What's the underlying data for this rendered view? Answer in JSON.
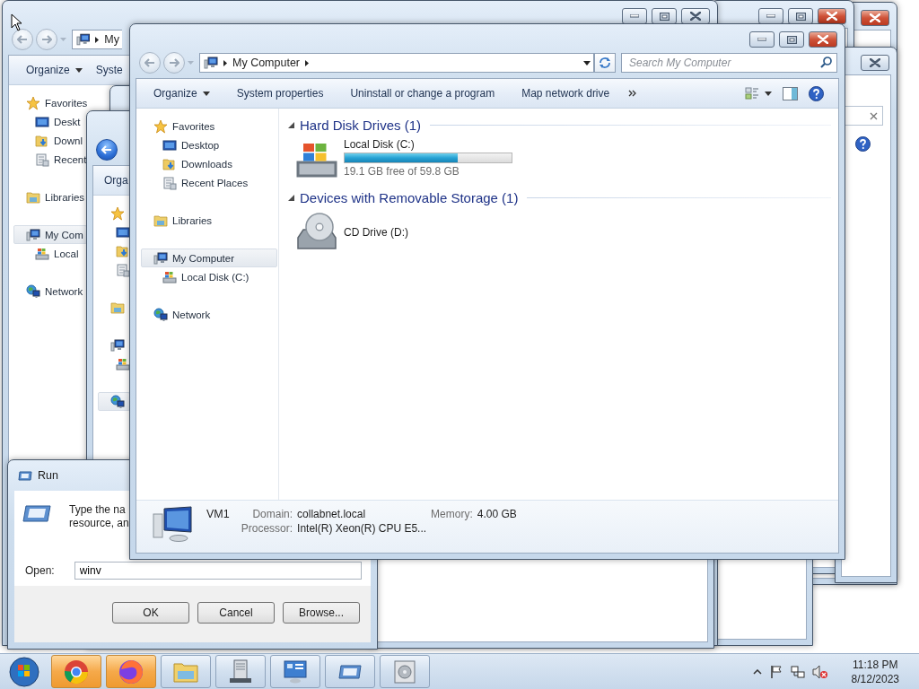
{
  "back_explorer": {
    "back_enabled": false,
    "address": "My",
    "toolbar": [
      {
        "label": "Organize",
        "dropdown": true
      },
      {
        "label": "Syste",
        "dropdown": false
      }
    ],
    "nav": [
      {
        "label": "Favorites",
        "kind": "favorites",
        "selected": false,
        "children": [
          {
            "label": "Deskt",
            "kind": "desktop",
            "selected": false
          },
          {
            "label": "Downl",
            "kind": "downloads",
            "selected": false
          },
          {
            "label": "Recent",
            "kind": "recent",
            "selected": false
          }
        ]
      },
      {
        "label": "Libraries",
        "kind": "libraries",
        "selected": false
      },
      {
        "label": "My Com",
        "kind": "computer",
        "selected": true,
        "children": [
          {
            "label": "Local",
            "kind": "disk",
            "selected": false
          }
        ]
      },
      {
        "label": "Network",
        "kind": "network",
        "selected": false
      }
    ]
  },
  "middle_explorer": {
    "back_enabled": true,
    "toolbar": [
      {
        "label": "Orga"
      }
    ],
    "nav": [
      {
        "kind": "favorites",
        "selected": false,
        "children": [
          {
            "kind": "desktop",
            "selected": false
          },
          {
            "kind": "downloads",
            "selected": false
          },
          {
            "kind": "recent",
            "selected": false
          }
        ]
      },
      {
        "kind": "libraries",
        "selected": false
      },
      {
        "kind": "computer",
        "selected": false,
        "children": [
          {
            "kind": "disk",
            "selected": false
          }
        ]
      },
      {
        "kind": "network",
        "selected": true
      }
    ]
  },
  "run_dialog": {
    "title": "Run",
    "prompt": [
      "Type the na",
      "resource, an"
    ],
    "open_label": "Open:",
    "value": "winv",
    "buttons": [
      "OK",
      "Cancel",
      "Browse..."
    ]
  },
  "main_window": {
    "back_enabled": false,
    "address": "My Computer",
    "search": {
      "placeholder": "Search My Computer"
    },
    "toolbar": [
      {
        "label": "Organize",
        "dropdown": true
      },
      {
        "label": "System properties",
        "dropdown": false
      },
      {
        "label": "Uninstall or change a program",
        "dropdown": false
      },
      {
        "label": "Map network drive",
        "dropdown": false
      }
    ],
    "nav": [
      {
        "label": "Favorites",
        "kind": "favorites",
        "selected": false,
        "children": [
          {
            "label": "Desktop",
            "kind": "desktop",
            "selected": false
          },
          {
            "label": "Downloads",
            "kind": "downloads",
            "selected": false
          },
          {
            "label": "Recent Places",
            "kind": "recent",
            "selected": false
          }
        ]
      },
      {
        "label": "Libraries",
        "kind": "libraries",
        "selected": false
      },
      {
        "label": "My Computer",
        "kind": "computer",
        "selected": true,
        "children": [
          {
            "label": "Local Disk (C:)",
            "kind": "disk",
            "selected": false
          }
        ]
      },
      {
        "label": "Network",
        "kind": "network",
        "selected": false
      }
    ],
    "groups": [
      {
        "title": "Hard Disk Drives (1)",
        "expanded": true,
        "items": [
          {
            "name": "Local Disk (C:)",
            "kind": "disk",
            "level": 0.68,
            "detail": "19.1 GB free of 59.8 GB"
          }
        ]
      },
      {
        "title": "Devices with Removable Storage (1)",
        "expanded": true,
        "items": [
          {
            "name": "CD Drive (D:)",
            "kind": "cd"
          }
        ]
      }
    ],
    "details": {
      "name": "VM1",
      "fields": [
        {
          "label": "Domain:",
          "value": "collabnet.local"
        },
        {
          "label": "Memory:",
          "value": "4.00 GB"
        },
        {
          "label": "Processor:",
          "value": "Intel(R) Xeon(R) CPU E5..."
        }
      ]
    }
  },
  "taskbar": {
    "apps": [
      {
        "kind": "chrome",
        "flashing": true
      },
      {
        "kind": "firefox",
        "flashing": true
      },
      {
        "kind": "folder",
        "flashing": false
      },
      {
        "kind": "server",
        "flashing": false
      },
      {
        "kind": "control-panel",
        "flashing": false
      },
      {
        "kind": "run",
        "flashing": false
      },
      {
        "kind": "disk",
        "flashing": false
      }
    ],
    "clock": {
      "time": "11:18 PM",
      "date": "8/12/2023"
    }
  }
}
